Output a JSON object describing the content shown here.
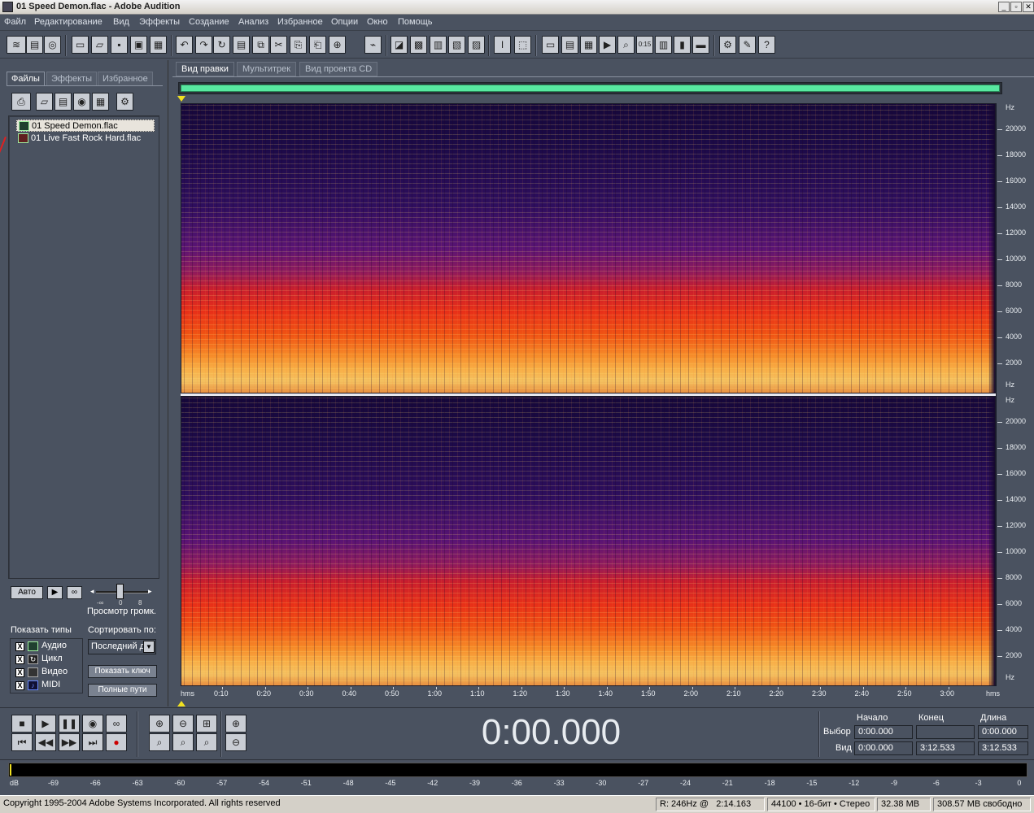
{
  "window": {
    "title": "01 Speed Demon.flac - Adobe Audition",
    "buttons": [
      "_",
      "▫",
      "✕"
    ]
  },
  "menu": [
    "Файл",
    "Редактирование",
    "Вид",
    "Эффекты",
    "Создание",
    "Анализ",
    "Избранное",
    "Опции",
    "Окно",
    "Помощь"
  ],
  "left_panel": {
    "tabs": [
      "Файлы",
      "Эффекты",
      "Избранное"
    ],
    "files": [
      "01 Speed Demon.flac",
      "01 Live Fast Rock Hard.flac"
    ],
    "auto_button": "Авто",
    "play_button": "▶",
    "loop_button": "∞",
    "volume_label": "Просмотр громк.",
    "volume_ticks": [
      "-∞",
      "0",
      "8"
    ],
    "show_types_label": "Показать типы",
    "types": [
      {
        "label": "Аудио",
        "checked": "X"
      },
      {
        "label": "Цикл",
        "checked": "X"
      },
      {
        "label": "Видео",
        "checked": "X"
      },
      {
        "label": "MIDI",
        "checked": "X"
      }
    ],
    "sort_label": "Сортировать по:",
    "sort_value": "Последний д",
    "show_button": "Показать ключ",
    "full_paths_button": "Полные пути"
  },
  "view_tabs": [
    "Вид правки",
    "Мультитрек",
    "Вид проекта CD"
  ],
  "spectrogram": {
    "hz_unit": "Hz",
    "hz_labels": [
      "20000",
      "18000",
      "16000",
      "14000",
      "12000",
      "10000",
      "8000",
      "6000",
      "4000",
      "2000"
    ],
    "time_labels": [
      "hms",
      "0:10",
      "0:20",
      "0:30",
      "0:40",
      "0:50",
      "1:00",
      "1:10",
      "1:20",
      "1:30",
      "1:40",
      "1:50",
      "2:00",
      "2:10",
      "2:20",
      "2:30",
      "2:40",
      "2:50",
      "3:00",
      "hms"
    ]
  },
  "transport": {
    "time": "0:00.000",
    "headers": {
      "start": "Начало",
      "end": "Конец",
      "length": "Длина"
    },
    "rows": [
      {
        "label": "Выбор",
        "start": "0:00.000",
        "end": "",
        "length": "0:00.000"
      },
      {
        "label": "Вид",
        "start": "0:00.000",
        "end": "3:12.533",
        "length": "3:12.533"
      }
    ]
  },
  "level_meter": {
    "labels": [
      "dB",
      "-69",
      "-66",
      "-63",
      "-60",
      "-57",
      "-54",
      "-51",
      "-48",
      "-45",
      "-42",
      "-39",
      "-36",
      "-33",
      "-30",
      "-27",
      "-24",
      "-21",
      "-18",
      "-15",
      "-12",
      "-9",
      "-6",
      "-3",
      "0"
    ]
  },
  "status": {
    "copyright": "Copyright 1995-2004 Adobe Systems Incorporated. All rights reserved",
    "cursor": "R: 246Hz @   2:14.163",
    "format": "44100 • 16-бит • Стерео",
    "size": "32.38 MB",
    "free": "308.57 MB свободно"
  }
}
